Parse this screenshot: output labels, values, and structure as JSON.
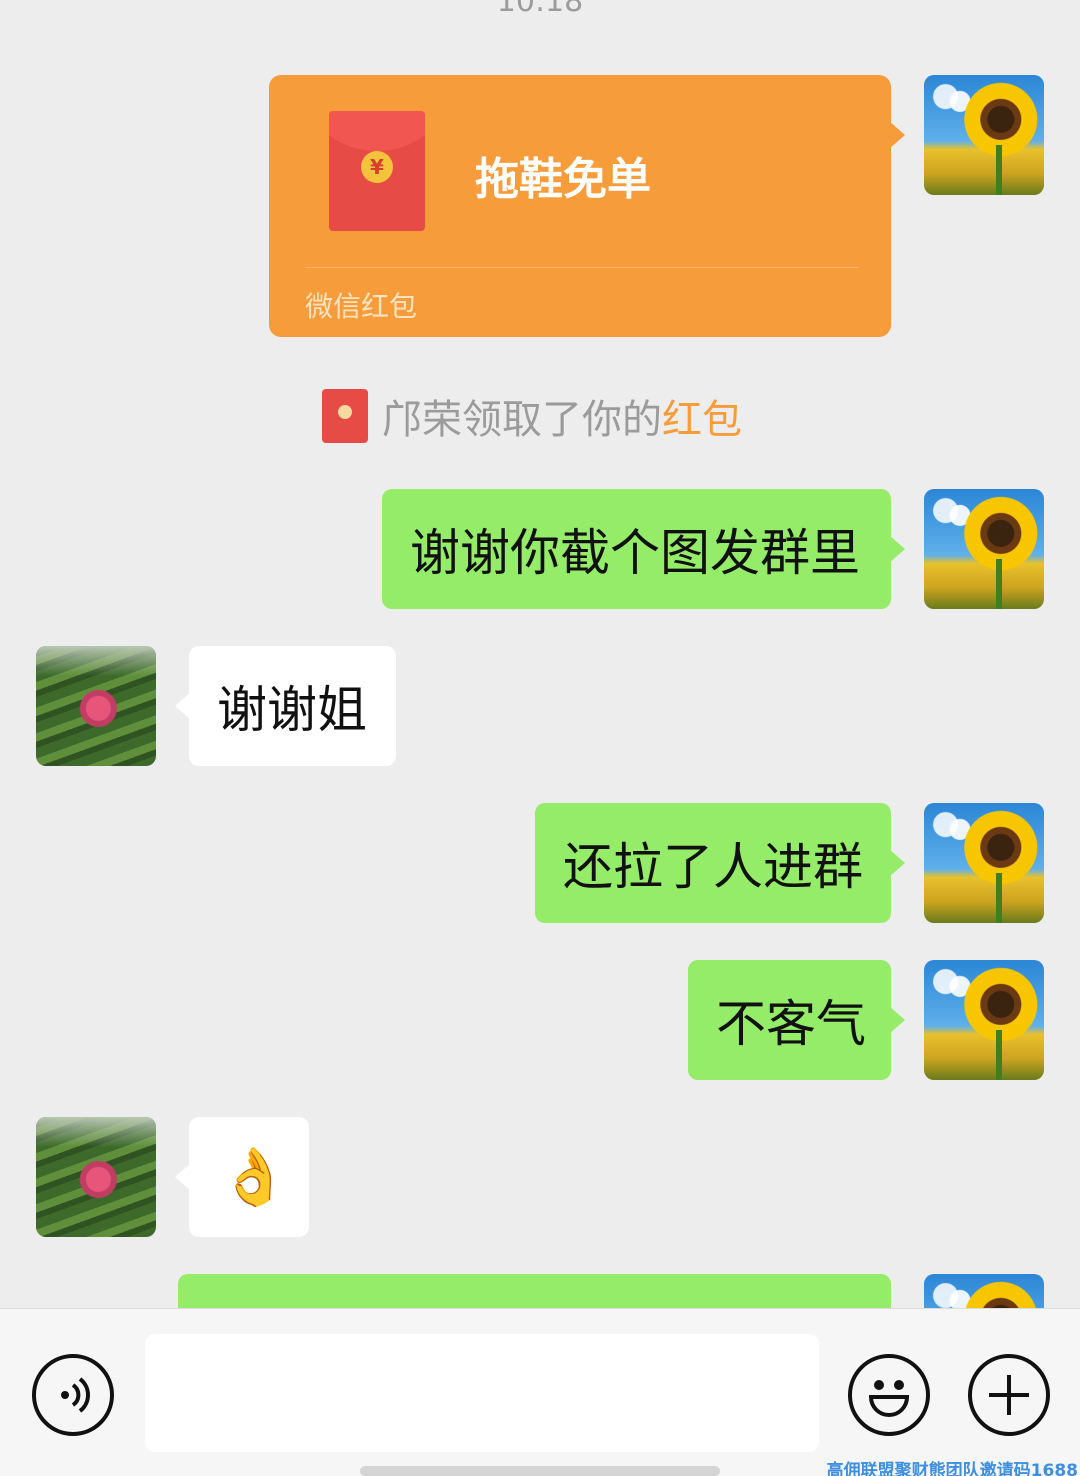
{
  "chat": {
    "timestamp": "10:18",
    "red_packet": {
      "title": "拖鞋免单",
      "footer": "微信红包",
      "coin_symbol": "¥",
      "color": "#f79c3a"
    },
    "system_note": {
      "text": "邝荣领取了你的",
      "highlight": "红包"
    },
    "messages": [
      {
        "side": "me",
        "text": "谢谢你截个图发群里"
      },
      {
        "side": "other",
        "text": "谢谢姐"
      },
      {
        "side": "me",
        "text": "还拉了人进群"
      },
      {
        "side": "me",
        "text": "不客气"
      },
      {
        "side": "other",
        "text": "👌"
      },
      {
        "side": "me",
        "text": ""
      }
    ],
    "colors": {
      "sent_bubble": "#95ec69",
      "received_bubble": "#ffffff",
      "background": "#ededed"
    }
  },
  "input_bar": {
    "voice_icon": "voice-icon",
    "emoji_icon": "smiley-icon",
    "more_icon": "plus-icon",
    "placeholder": ""
  },
  "watermark": "高佣联盟聚财熊团队邀请码1688"
}
